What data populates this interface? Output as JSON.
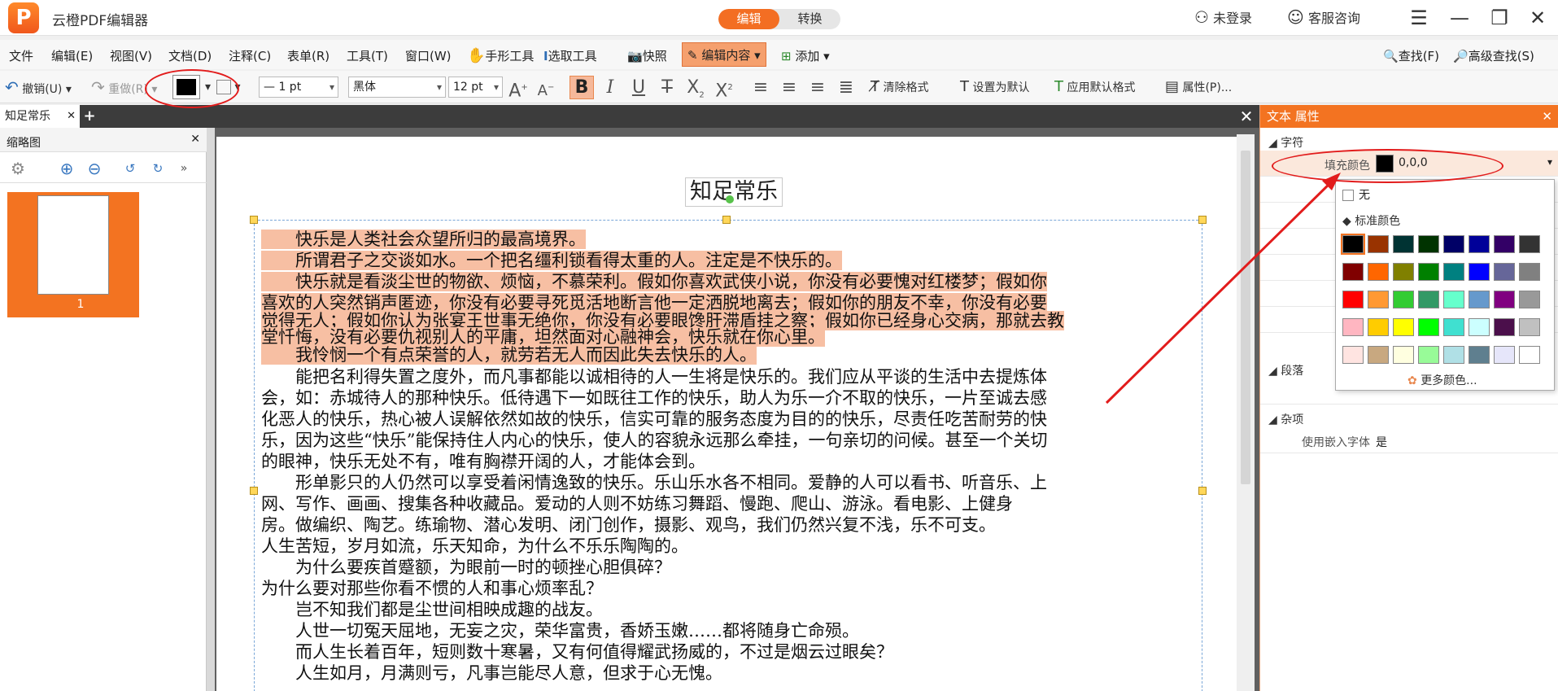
{
  "titlebar": {
    "app_title": "云橙PDF编辑器",
    "mode_edit": "编辑",
    "mode_convert": "转换",
    "login": "未登录",
    "service": "客服咨询"
  },
  "menubar": {
    "items": [
      "文件",
      "编辑(E)",
      "视图(V)",
      "文档(D)",
      "注释(C)",
      "表单(R)",
      "工具(T)",
      "窗口(W)"
    ],
    "hand_tool": "手形工具",
    "select_tool": "选取工具",
    "snapshot": "快照",
    "edit_content": "编辑内容",
    "add": "添加",
    "find": "查找(F)",
    "adv_find": "高级查找(S)"
  },
  "fmtbar": {
    "undo": "撤销(U)",
    "redo": "重做(R)",
    "line_width": "— 1 pt",
    "font": "黑体",
    "font_size": "12 pt",
    "clear_format": "清除格式",
    "set_default": "设置为默认",
    "apply_default": "应用默认格式",
    "properties": "属性(P)..."
  },
  "tabs": {
    "doc_tab": "知足常乐"
  },
  "thumbs": {
    "title": "缩略图",
    "page_num": "1"
  },
  "document": {
    "title": "知足常乐",
    "lines": [
      "　　快乐是人类社会众望所归的最高境界。",
      "　　所谓君子之交谈如水。一个把名缰利锁看得太重的人。注定是不快乐的。",
      "　　快乐就是看淡尘世的物欲、烦恼，不慕荣利。假如你喜欢武侠小说，你没有必要愧对红楼梦；假如你",
      "喜欢的人突然销声匿迹，你没有必要寻死觅活地断言他一定洒脱地离去；假如你的朋友不幸，你没有必要",
      "觉得无人；假如你认为张宴王世事无绝你，你没有必要眼馋肝滞盾挂之察；假如你已经身心交病，那就去教",
      "堂忏悔，没有必要仇视别人的平庸，坦然面对心融神会，快乐就在你心里。",
      "　　我怜悯一个有点荣誉的人，就劳若无人而因此失去快乐的人。",
      "　　能把名利得失置之度外，而凡事都能以诚相待的人一生将是快乐的。我们应从平谈的生活中去提炼体",
      "会，如：赤城待人的那种快乐。低待遇下一如既往工作的快乐，助人为乐一介不取的快乐，一片至诚去感",
      "化恶人的快乐，热心被人误解依然如故的快乐，信实可靠的服务态度为目的的快乐，尽责任吃苦耐劳的快",
      "乐，因为这些“快乐”能保持住人内心的快乐，使人的容貌永远那么牵挂，一句亲切的问候。甚至一个关切",
      "的眼神，快乐无处不有，唯有胸襟开阔的人，才能体会到。",
      "　　形单影只的人仍然可以享受着闲情逸致的快乐。乐山乐水各不相同。爱静的人可以看书、听音乐、上",
      "网、写作、画画、搜集各种收藏品。爱动的人则不妨练习舞蹈、慢跑、爬山、游泳。看电影、上健身",
      "房。做编织、陶艺。练瑜物、潜心发明、闭门创作，摄影、观鸟，我们仍然兴复不浅，乐不可支。",
      "人生苦短，岁月如流，乐天知命，为什么不乐乐陶陶的。",
      "　　为什么要疾首蹙额，为眼前一时的顿挫心胆俱碎？",
      "为什么要对那些你看不惯的人和事心烦率乱？",
      "　　岂不知我们都是尘世间相映成趣的战友。",
      "　　人世一切冤天屈地，无妄之灾，荣华富贵，香娇玉嫩……都将随身亡命殒。",
      "　　而人生长着百年，短则数十寒暑，又有何值得耀武扬威的，不过是烟云过眼矣？",
      "　　人生如月，月满则亏，凡事岂能尽人意，但求于心无愧。"
    ]
  },
  "props": {
    "title": "文本 属性",
    "section_char": "字符",
    "fill_color_label": "填充颜色",
    "fill_color_value": "0,0,0",
    "section_para": "段落",
    "section_misc": "杂项",
    "embed_font_label": "使用嵌入字体",
    "embed_font_value": "是"
  },
  "color_popup": {
    "none": "无",
    "standard": "标准颜色",
    "more": "更多颜色...",
    "colors": [
      "#000000",
      "#993300",
      "#003333",
      "#003300",
      "#000066",
      "#000099",
      "#330066",
      "#333333",
      "#800000",
      "#ff6600",
      "#808000",
      "#008000",
      "#008080",
      "#0000ff",
      "#666699",
      "#808080",
      "#ff0000",
      "#ff9933",
      "#33cc33",
      "#339966",
      "#66ffcc",
      "#6699cc",
      "#800080",
      "#999999",
      "#ffb6c1",
      "#ffcc00",
      "#ffff00",
      "#00ff00",
      "#40e0d0",
      "#ccffff",
      "#4b0f4b",
      "#c0c0c0",
      "#ffe4e1",
      "#c8a880",
      "#ffffe0",
      "#98fb98",
      "#b0e0e6",
      "#5f7f8f",
      "#e6e6fa",
      "#ffffff"
    ]
  },
  "colors": {
    "accent": "#f37321",
    "highlight": "#f7bfa3",
    "annotation": "#e21c1c"
  }
}
